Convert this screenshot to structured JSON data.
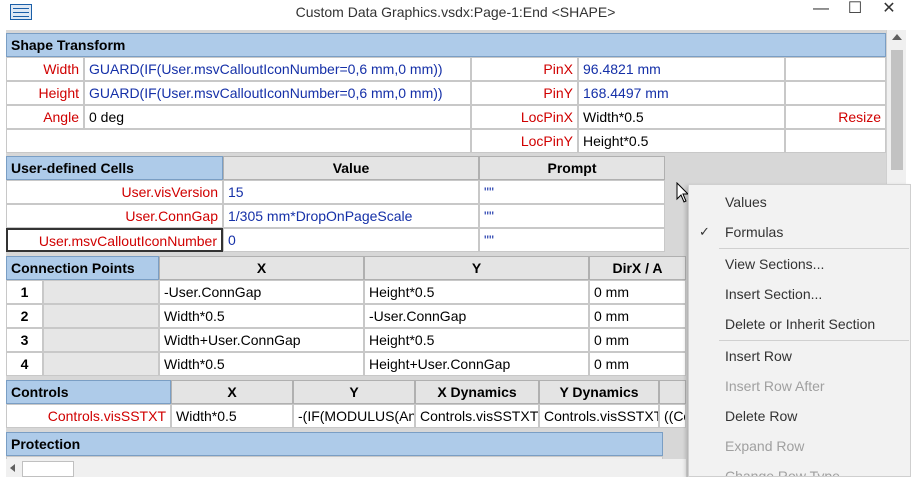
{
  "window": {
    "title": "Custom Data Graphics.vsdx:Page-1:End <SHAPE>",
    "minimize": "—",
    "maximize": "☐",
    "close": "✕"
  },
  "shape_transform": {
    "header": "Shape Transform",
    "rows": [
      {
        "label": "Width",
        "value": "GUARD(IF(User.msvCalloutIconNumber=0,6 mm,0 mm))",
        "label2": "PinX",
        "value2": "96.4821 mm"
      },
      {
        "label": "Height",
        "value": "GUARD(IF(User.msvCalloutIconNumber=0,6 mm,0 mm))",
        "label2": "PinY",
        "value2": "168.4497 mm"
      },
      {
        "label": "Angle",
        "value": "0 deg",
        "label2": "LocPinX",
        "value2": "Width*0.5",
        "label3": "Resize"
      },
      {
        "label": "",
        "value": "",
        "label2": "LocPinY",
        "value2": "Height*0.5"
      }
    ]
  },
  "user_cells": {
    "header": "User-defined Cells",
    "col_value": "Value",
    "col_prompt": "Prompt",
    "rows": [
      {
        "name": "User.visVersion",
        "value": "15",
        "prompt": "\"\""
      },
      {
        "name": "User.ConnGap",
        "value": "1/305 mm*DropOnPageScale",
        "prompt": "\"\""
      },
      {
        "name": "User.msvCalloutIconNumber",
        "value": "0",
        "prompt": "\"\""
      }
    ]
  },
  "connection_points": {
    "header": "Connection Points",
    "col_x": "X",
    "col_y": "Y",
    "col_dir": "DirX / A",
    "rows": [
      {
        "n": "1",
        "x": "-User.ConnGap",
        "y": "Height*0.5",
        "d": "0 mm"
      },
      {
        "n": "2",
        "x": "Width*0.5",
        "y": "-User.ConnGap",
        "d": "0 mm"
      },
      {
        "n": "3",
        "x": "Width+User.ConnGap",
        "y": "Height*0.5",
        "d": "0 mm"
      },
      {
        "n": "4",
        "x": "Width*0.5",
        "y": "Height+User.ConnGap",
        "d": "0 mm"
      }
    ]
  },
  "controls": {
    "header": "Controls",
    "col_x": "X",
    "col_y": "Y",
    "col_xdyn": "X Dynamics",
    "col_ydyn": "Y Dynamics",
    "row": {
      "name": "Controls.visSSTXT",
      "x": "Width*0.5",
      "y": "-(IF(MODULUS(An",
      "xdyn": "Controls.visSSTXT",
      "ydyn": "Controls.visSSTXT",
      "extra": "((Co"
    }
  },
  "protection": {
    "header": "Protection"
  },
  "context_menu": {
    "items": [
      {
        "label": "Values",
        "checked": false,
        "disabled": false
      },
      {
        "label": "Formulas",
        "checked": true,
        "disabled": false
      },
      {
        "label": "View Sections...",
        "checked": false,
        "disabled": false
      },
      {
        "label": "Insert Section...",
        "checked": false,
        "disabled": false
      },
      {
        "label": "Delete or Inherit Section",
        "checked": false,
        "disabled": false
      },
      {
        "label": "Insert Row",
        "checked": false,
        "disabled": false
      },
      {
        "label": "Insert Row After",
        "checked": false,
        "disabled": true
      },
      {
        "label": "Delete Row",
        "checked": false,
        "disabled": false
      },
      {
        "label": "Expand Row",
        "checked": false,
        "disabled": true
      },
      {
        "label": "Change Row Type",
        "checked": false,
        "disabled": true
      }
    ],
    "checkmark": "✓"
  }
}
